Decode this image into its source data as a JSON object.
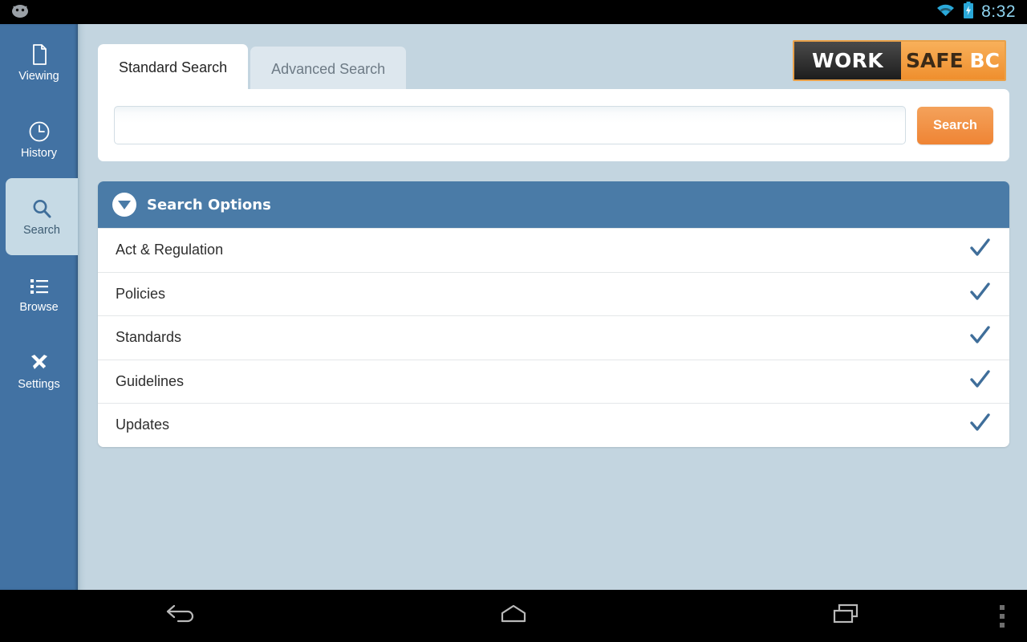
{
  "status_bar": {
    "app_icon": "android-robot-icon",
    "wifi_icon": "wifi-icon",
    "battery_icon": "battery-charging-icon",
    "time": "8:32"
  },
  "sidebar": {
    "items": [
      {
        "label": "Viewing",
        "icon": "document-icon",
        "active": false
      },
      {
        "label": "History",
        "icon": "clock-icon",
        "active": false
      },
      {
        "label": "Search",
        "icon": "magnifier-icon",
        "active": true
      },
      {
        "label": "Browse",
        "icon": "list-icon",
        "active": false
      },
      {
        "label": "Settings",
        "icon": "tools-icon",
        "active": false
      }
    ]
  },
  "tabs": [
    {
      "label": "Standard Search",
      "active": true
    },
    {
      "label": "Advanced Search",
      "active": false
    }
  ],
  "logo": {
    "work": "WORK",
    "safe": "SAFE",
    "bc": "BC"
  },
  "search": {
    "value": "",
    "placeholder": "",
    "button_label": "Search"
  },
  "search_options": {
    "title": "Search Options",
    "toggle_icon": "chevron-down-circle-icon",
    "rows": [
      {
        "label": "Act & Regulation",
        "checked": true
      },
      {
        "label": "Policies",
        "checked": true
      },
      {
        "label": "Standards",
        "checked": true
      },
      {
        "label": "Guidelines",
        "checked": true
      },
      {
        "label": "Updates",
        "checked": true
      }
    ]
  },
  "nav_bar": {
    "back": "back-icon",
    "home": "home-icon",
    "recents": "recents-icon",
    "overflow": "overflow-menu-icon"
  },
  "colors": {
    "sidebar_blue": "#4272a3",
    "content_bg": "#c3d5e0",
    "header_blue": "#4a7ba7",
    "accent_orange": "#ef8f2e",
    "check_blue": "#3f6e9a"
  }
}
